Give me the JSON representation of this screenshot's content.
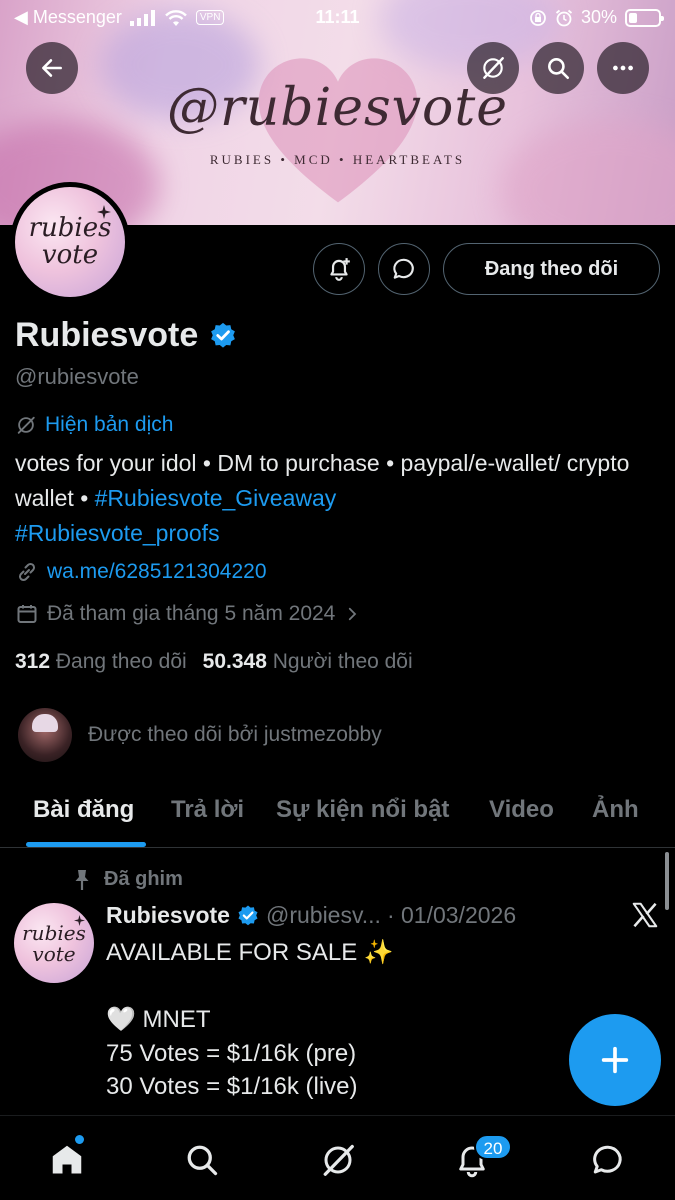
{
  "status_bar": {
    "back_app": "◀ Messenger",
    "vpn": "VPN",
    "time": "11:11",
    "battery": "30%",
    "battery_level": 0.3
  },
  "banner": {
    "title": "@rubiesvote",
    "subtitle": "RUBIES • MCD • HEARTBEATS"
  },
  "avatar": {
    "line1": "rubies",
    "line2": "vote"
  },
  "actions": {
    "follow_label": "Đang theo dõi"
  },
  "profile": {
    "name": "Rubiesvote",
    "handle": "@rubiesvote",
    "translate": "Hiện bản dịch",
    "bio_text_1": "votes for your idol • DM to purchase • paypal/e-wallet/ crypto wallet • ",
    "bio_tag_1": "#Rubiesvote_Giveaway",
    "bio_tag_2": "#Rubiesvote_proofs",
    "link": "wa.me/6285121304220",
    "joined": "Đã tham gia tháng 5 năm 2024",
    "following_count": "312",
    "following_label": "Đang theo dõi",
    "followers_count": "50.348",
    "followers_label": "Người theo dõi",
    "followed_by": "Được theo dõi bởi justmezobby"
  },
  "tabs": [
    "Bài đăng",
    "Trả lời",
    "Sự kiện nổi bật",
    "Video",
    "Ảnh"
  ],
  "tweet": {
    "pinned_label": "Đã ghim",
    "author": "Rubiesvote",
    "handle": "@rubiesv...",
    "date": "· 01/03/2026",
    "body": "AVAILABLE FOR SALE ✨\n\n🤍 MNET\n75 Votes = $1/16k (pre)\n30 Votes = $1/16k (live)"
  },
  "bottom_nav": {
    "notifications_badge": "20"
  },
  "colors": {
    "accent": "#1d9bf0",
    "background": "#000000",
    "muted": "#71767b",
    "verified": "#1d9bf0"
  }
}
